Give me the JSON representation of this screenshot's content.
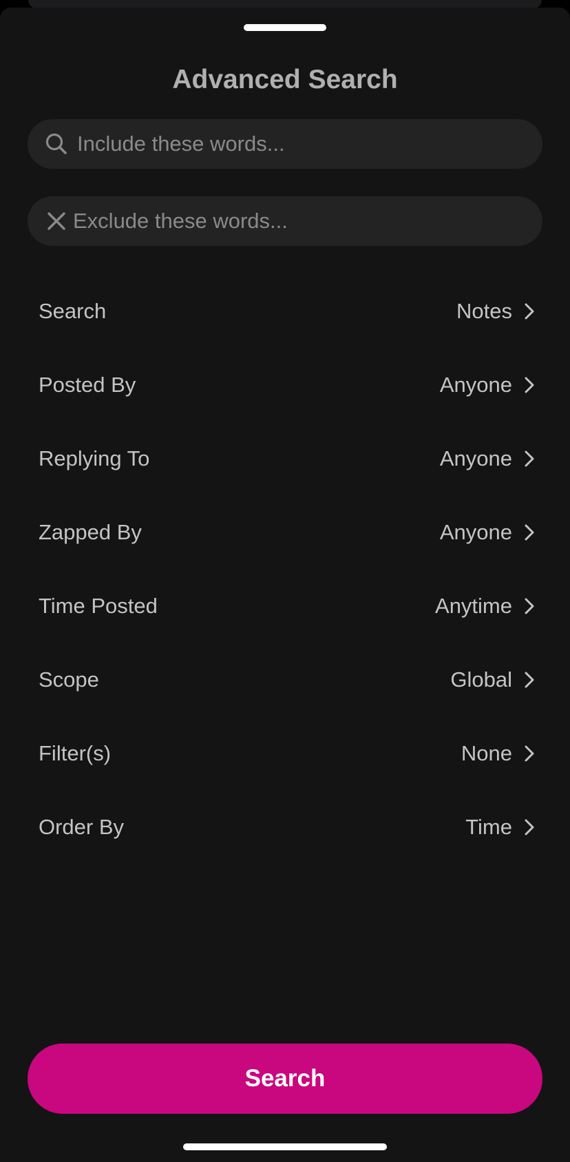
{
  "sheet": {
    "title": "Advanced Search"
  },
  "include_field": {
    "placeholder": "Include these words...",
    "value": "",
    "icon": "search-icon"
  },
  "exclude_field": {
    "placeholder": "Exclude these words...",
    "value": "",
    "icon": "close-icon"
  },
  "options": [
    {
      "label": "Search",
      "value": "Notes"
    },
    {
      "label": "Posted By",
      "value": "Anyone"
    },
    {
      "label": "Replying To",
      "value": "Anyone"
    },
    {
      "label": "Zapped By",
      "value": "Anyone"
    },
    {
      "label": "Time Posted",
      "value": "Anytime"
    },
    {
      "label": "Scope",
      "value": "Global"
    },
    {
      "label": "Filter(s)",
      "value": "None"
    },
    {
      "label": "Order By",
      "value": "Time"
    }
  ],
  "search_button": {
    "label": "Search"
  },
  "colors": {
    "background": "#141414",
    "field_background": "#232323",
    "accent": "#c9077f",
    "text": "#c4c4c4",
    "title": "#b0b0b0"
  }
}
